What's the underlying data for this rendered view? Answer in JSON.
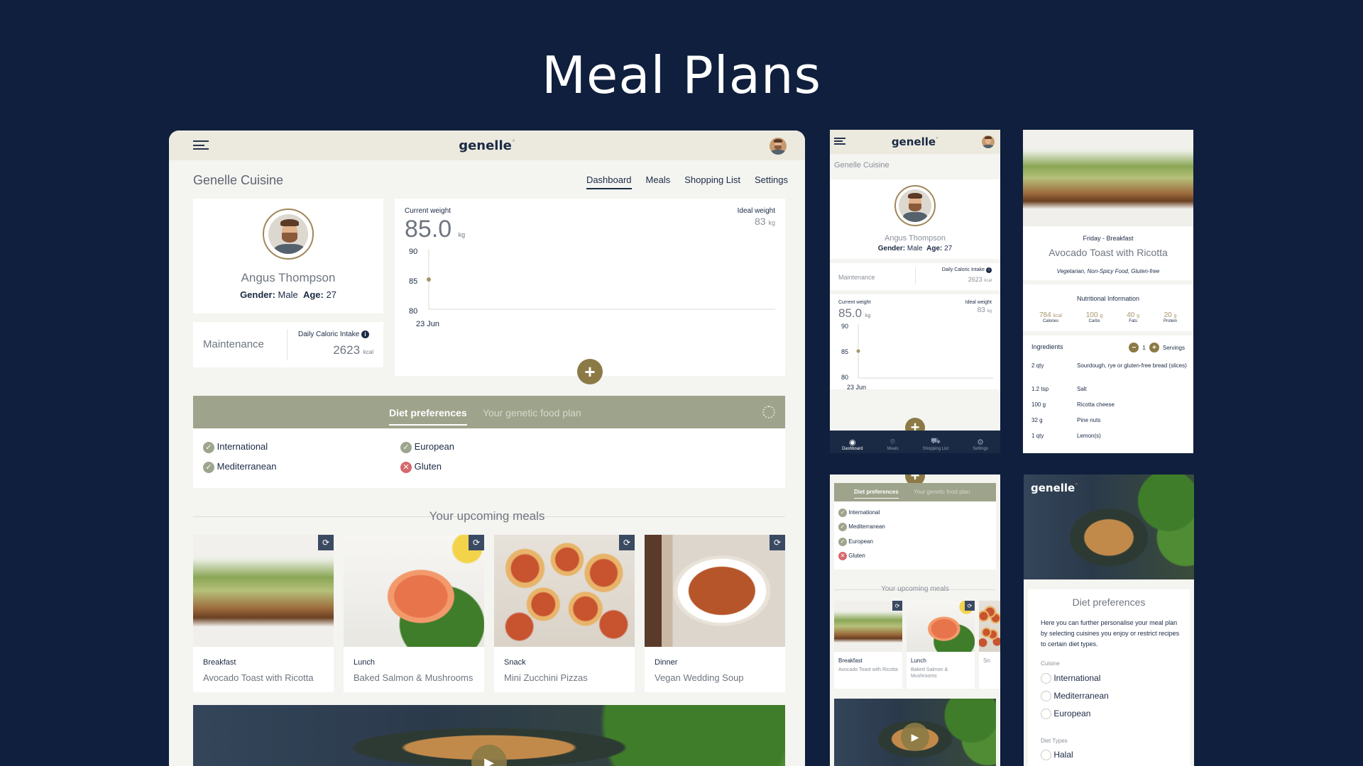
{
  "page_title": "Meal Plans",
  "brand": {
    "logo": "genelle",
    "logo_mark": "°"
  },
  "colors": {
    "background": "#0f1f3d",
    "accent": "#8b7a45",
    "band": "#9ea38b",
    "check": "#9ea58e",
    "cross": "#d7686e"
  },
  "icons": {
    "menu": "hamburger-icon",
    "add": "plus-icon",
    "swap": "refresh-icon",
    "settings": "gear-icon",
    "info": "info-icon",
    "play": "play-icon"
  },
  "desktop": {
    "section_title": "Genelle Cuisine",
    "nav": [
      "Dashboard",
      "Meals",
      "Shopping List",
      "Settings"
    ],
    "nav_active": "Dashboard",
    "profile": {
      "name": "Angus Thompson",
      "gender_label": "Gender:",
      "gender": "Male",
      "age_label": "Age:",
      "age": "27"
    },
    "goal": "Maintenance",
    "calorie": {
      "label": "Daily Caloric Intake",
      "value": "2623",
      "unit": "kcal"
    },
    "weight": {
      "current_label": "Current weight",
      "current": "85.0",
      "unit": "kg",
      "ideal_label": "Ideal weight",
      "ideal": "83",
      "ideal_unit": "kg"
    },
    "chart_ticks": [
      "90",
      "85",
      "80"
    ],
    "chart_date": "23 Jun",
    "tabs": [
      "Diet preferences",
      "Your genetic food plan"
    ],
    "preferences": [
      {
        "label": "International",
        "ok": true
      },
      {
        "label": "European",
        "ok": true
      },
      {
        "label": "Mediterranean",
        "ok": true
      },
      {
        "label": "Gluten",
        "ok": false
      }
    ],
    "upcoming_title": "Your upcoming meals",
    "meals": [
      {
        "type": "Breakfast",
        "name": "Avocado Toast with Ricotta"
      },
      {
        "type": "Lunch",
        "name": "Baked Salmon & Mushrooms"
      },
      {
        "type": "Snack",
        "name": "Mini Zucchini Pizzas"
      },
      {
        "type": "Dinner",
        "name": "Vegan Wedding Soup"
      }
    ]
  },
  "chart_data": {
    "type": "line",
    "x": [
      "23 Jun"
    ],
    "series": [
      {
        "values": [
          85
        ]
      }
    ],
    "ylim": [
      80,
      90
    ],
    "y_ticks": [
      90,
      85,
      80
    ]
  },
  "mobile": {
    "section_title": "Genelle Cuisine",
    "name": "Angus Thompson",
    "gender_label": "Gender:",
    "gender": "Male",
    "age_label": "Age:",
    "age": "27",
    "goal": "Maintenance",
    "calorie_label": "Daily Caloric Intake",
    "calorie_value": "2623",
    "calorie_unit": "kcal",
    "current_label": "Current weight",
    "current": "85.0",
    "unit": "kg",
    "ideal_label": "Ideal weight",
    "ideal": "83",
    "ideal_unit": "kg",
    "ticks": [
      "90",
      "85",
      "80"
    ],
    "date": "23 Jun",
    "bottom_nav": [
      "Dashboard",
      "Meals",
      "Shopping List",
      "Settings"
    ],
    "tabs": [
      "Diet preferences",
      "Your genetic food plan"
    ],
    "preferences": [
      "International",
      "Mediterranean",
      "European",
      "Gluten"
    ],
    "upcoming_title": "Your upcoming meals",
    "meals": [
      {
        "type": "Breakfast",
        "name": "Avocado Toast with Ricotta"
      },
      {
        "type": "Lunch",
        "name": "Baked Salmon & Mushrooms"
      },
      {
        "type": "Sn",
        "name": ""
      }
    ]
  },
  "recipe": {
    "day": "Friday - Breakfast",
    "title": "Avocado Toast with Ricotta",
    "tags": "Vegetarian, Non-Spicy Food, Gluten-free",
    "nutrition_title": "Nutritional Information",
    "nutrition": [
      {
        "value": "784",
        "unit": "kcal",
        "label": "Calories"
      },
      {
        "value": "100",
        "unit": "g",
        "label": "Carbs"
      },
      {
        "value": "40",
        "unit": "g",
        "label": "Fats"
      },
      {
        "value": "20",
        "unit": "g",
        "label": "Protein"
      }
    ],
    "ingredients_label": "Ingredients",
    "servings": "1",
    "servings_label": "Servings",
    "ingredients": [
      {
        "qty": "2 qty",
        "item": "Sourdough, rye or gluten-free bread (slices)"
      },
      {
        "qty": "1.2 tsp",
        "item": "Salt"
      },
      {
        "qty": "100 g",
        "item": "Ricotta cheese"
      },
      {
        "qty": "32 g",
        "item": "Pine nuts"
      },
      {
        "qty": "1 qty",
        "item": "Lemon(s)"
      }
    ]
  },
  "diet_prefs_screen": {
    "logo": "genelle",
    "title": "Diet preferences",
    "description": "Here you can further personalise your meal plan by selecting cuisines you enjoy or restrict recipes to certain diet types.",
    "cuisine_label": "Cuisine",
    "cuisines": [
      "International",
      "Mediterranean",
      "European"
    ],
    "diet_types_label": "Diet Types",
    "diet_types": [
      "Halal"
    ]
  }
}
